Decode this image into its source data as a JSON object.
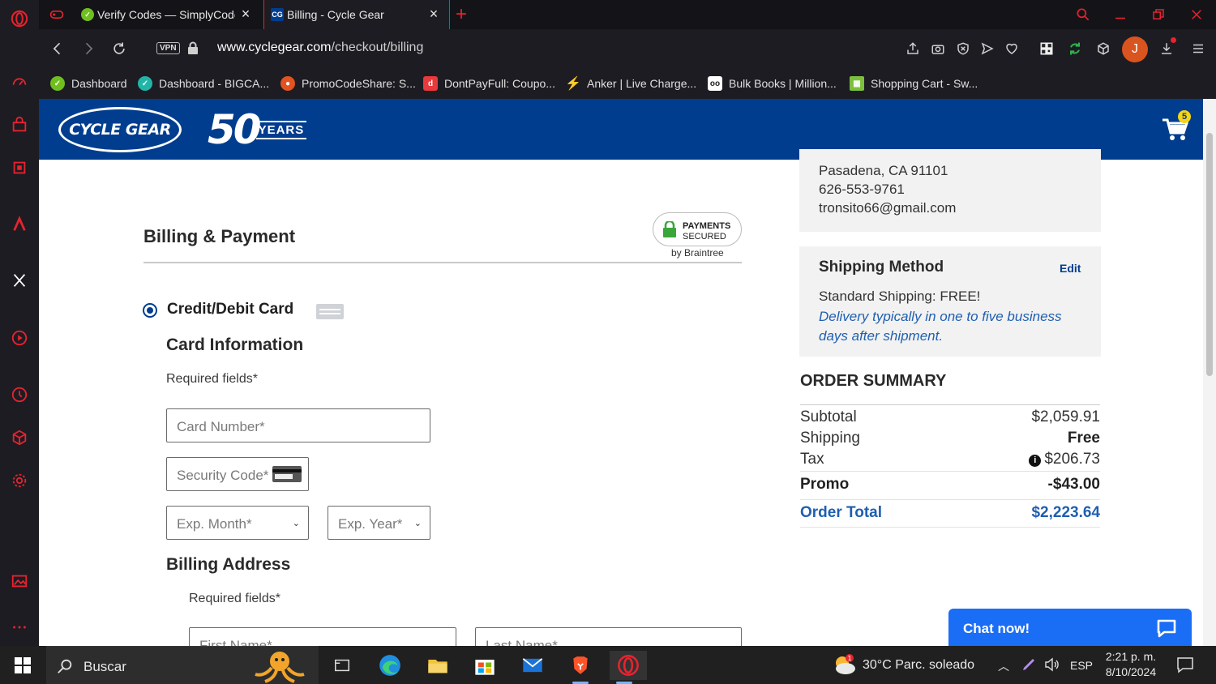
{
  "tabs": [
    {
      "title": "Verify Codes — SimplyCodes"
    },
    {
      "title": "Billing - Cycle Gear",
      "favicon": "CG"
    }
  ],
  "address": {
    "vpn": "VPN",
    "host": "www.cyclegear.com",
    "path": "/checkout/billing"
  },
  "profile_initial": "J",
  "bookmarks": [
    {
      "label": "Dashboard",
      "color": "#6fbf1e"
    },
    {
      "label": "Dashboard - BIGCA...",
      "color": "#21b5a8"
    },
    {
      "label": "PromoCodeShare: S...",
      "color": "#e2531f"
    },
    {
      "label": "DontPayFull: Coupo...",
      "color": "#e8393c"
    },
    {
      "label": "Anker | Live Charge...",
      "color": "#2d8cf0"
    },
    {
      "label": "Bulk Books | Million...",
      "color": "#ffffff"
    },
    {
      "label": "Shopping Cart - Sw...",
      "color": "#7cbf3e"
    }
  ],
  "site": {
    "logo_text": "CYCLE GEAR",
    "anniv_num": "50",
    "anniv_text": "YEARS",
    "cart_count": "5"
  },
  "billing": {
    "title": "Billing & Payment",
    "secure_line1": "PAYMENTS",
    "secure_line2": "SECURED",
    "secure_by": "by Braintree",
    "method_label": "Credit/Debit Card",
    "card_info_title": "Card Information",
    "required_fields": "Required fields*",
    "card_number_ph": "Card Number*",
    "security_code_ph": "Security Code*",
    "exp_month_ph": "Exp. Month*",
    "exp_year_ph": "Exp. Year*",
    "billing_address_title": "Billing Address",
    "required_fields_2": "Required fields*",
    "first_name_ph": "First Name*",
    "last_name_ph": "Last Name*"
  },
  "shipping_address": {
    "city_line": "Pasadena, CA 91101",
    "phone": "626-553-9761",
    "email": "tronsito66@gmail.com"
  },
  "shipping_method": {
    "title": "Shipping Method",
    "edit": "Edit",
    "standard": "Standard Shipping: FREE!",
    "note": "Delivery typically in one to five business days after shipment."
  },
  "order_summary": {
    "title": "ORDER SUMMARY",
    "subtotal_label": "Subtotal",
    "subtotal": "$2,059.91",
    "shipping_label": "Shipping",
    "shipping": "Free",
    "tax_label": "Tax",
    "tax": "$206.73",
    "promo_label": "Promo",
    "promo": "-$43.00",
    "total_label": "Order Total",
    "total": "$2,223.64"
  },
  "chat_label": "Chat now!",
  "taskbar": {
    "search": "Buscar",
    "weather": "30°C  Parc. soleado",
    "lang": "ESP",
    "time": "2:21 p. m.",
    "date": "8/10/2024"
  },
  "colors": {
    "brand_blue": "#003d8f",
    "opera_red": "#e8232f",
    "link_blue": "#1f5fb0",
    "chat_blue": "#1a6ef5"
  }
}
